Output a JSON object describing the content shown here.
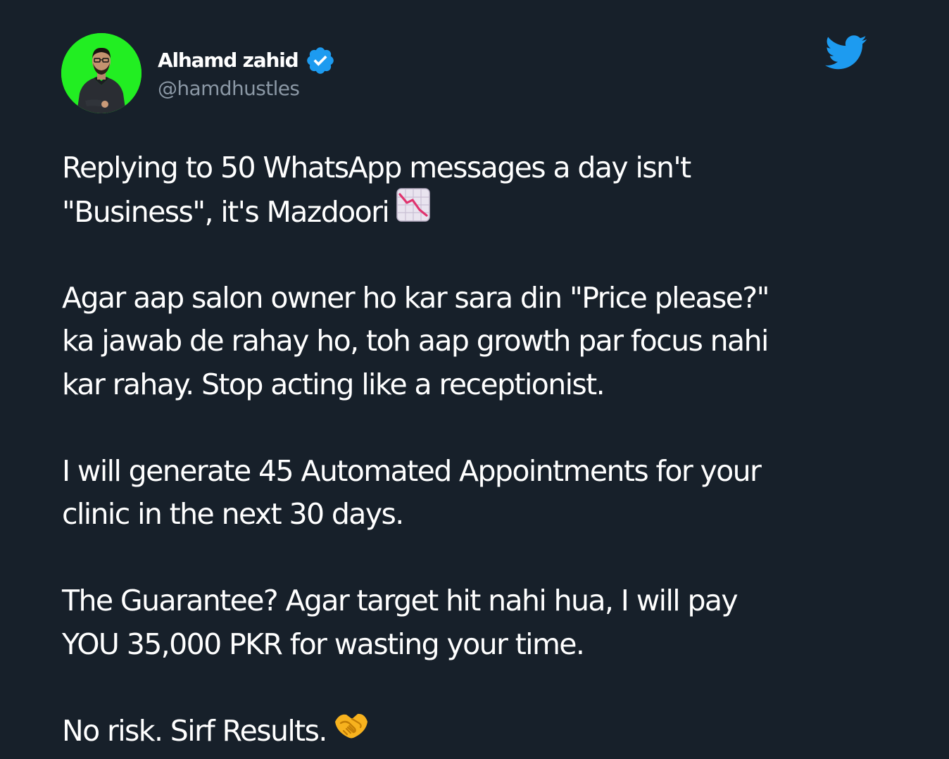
{
  "author": {
    "display_name": "Alhamd zahid",
    "handle": "@hamdhustles",
    "verified_icon": "verified-badge-icon",
    "avatar_icon": "profile-avatar"
  },
  "brand": {
    "logo_icon": "twitter-bird-icon",
    "accent_color": "#1d9bf0",
    "background_color": "#17202a",
    "text_color": "#ffffff",
    "muted_color": "#8b98a5"
  },
  "tweet": {
    "p1": {
      "line1": "Replying to 50 WhatsApp messages a day isn't",
      "line2": "\"Business\", it's Mazdoori",
      "emoji_icon": "chart-decreasing-icon"
    },
    "p2": {
      "line1": "Agar aap salon owner ho kar sara din \"Price please?\"",
      "line2": "ka jawab de rahay ho, toh aap growth par focus nahi",
      "line3": "kar rahay. Stop acting like a receptionist."
    },
    "p3": {
      "line1": "I will generate 45 Automated Appointments for your",
      "line2": "clinic in the next 30 days."
    },
    "p4": {
      "line1": "The Guarantee? Agar target hit nahi hua, I will pay",
      "line2": "YOU 35,000 PKR for wasting your time."
    },
    "p5": {
      "line1": "No risk. Sirf Results.",
      "emoji_icon": "handshake-icon"
    }
  }
}
